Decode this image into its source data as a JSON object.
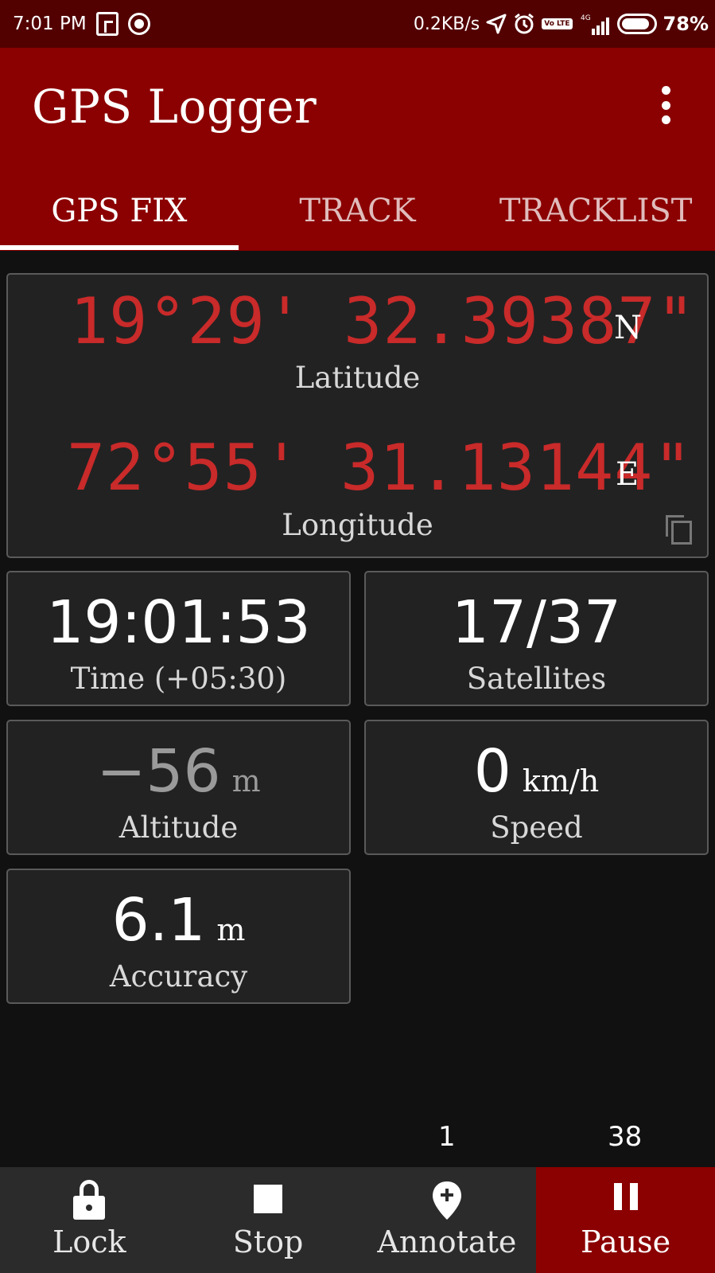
{
  "status_bar": {
    "time": "7:01 PM",
    "network_speed": "0.2KB/s",
    "network_type": "4G",
    "volte": "Vo LTE",
    "battery": "78%",
    "icons": [
      "bag-icon",
      "location-target-icon",
      "navigation-arrow-icon",
      "alarm-icon",
      "volte-icon",
      "signal-icon",
      "battery-icon"
    ]
  },
  "app_bar": {
    "title": "GPS Logger",
    "menu_icon": "more-vert-icon"
  },
  "tabs": [
    {
      "label": "GPS FIX",
      "active": true
    },
    {
      "label": "TRACK",
      "active": false
    },
    {
      "label": "TRACKLIST",
      "active": false
    }
  ],
  "coordinates": {
    "latitude": {
      "value": "19°29' 32.39387\"",
      "hemisphere": "N",
      "label": "Latitude"
    },
    "longitude": {
      "value": "72°55' 31.13144\"",
      "hemisphere": "E",
      "label": "Longitude"
    },
    "copy_icon": "copy-icon"
  },
  "stats": {
    "time": {
      "value": "19:01:53",
      "label": "Time (+05:30)"
    },
    "satellites": {
      "value": "17/37",
      "label": "Satellites"
    },
    "altitude": {
      "value": "−56",
      "unit": "m",
      "label": "Altitude"
    },
    "speed": {
      "value": "0",
      "unit": "km/h",
      "label": "Speed"
    },
    "accuracy": {
      "value": "6.1",
      "unit": "m",
      "label": "Accuracy"
    }
  },
  "counters": {
    "left": "1",
    "right": "38"
  },
  "actions": [
    {
      "label": "Lock",
      "icon": "lock-icon",
      "active": false
    },
    {
      "label": "Stop",
      "icon": "stop-icon",
      "active": false
    },
    {
      "label": "Annotate",
      "icon": "add-location-icon",
      "active": false
    },
    {
      "label": "Pause",
      "icon": "pause-icon",
      "active": true
    }
  ],
  "colors": {
    "status_bar": "#520000",
    "primary": "#8b0000",
    "coordinate_text": "#c92a2a",
    "background": "#111111",
    "card": "#222222"
  }
}
